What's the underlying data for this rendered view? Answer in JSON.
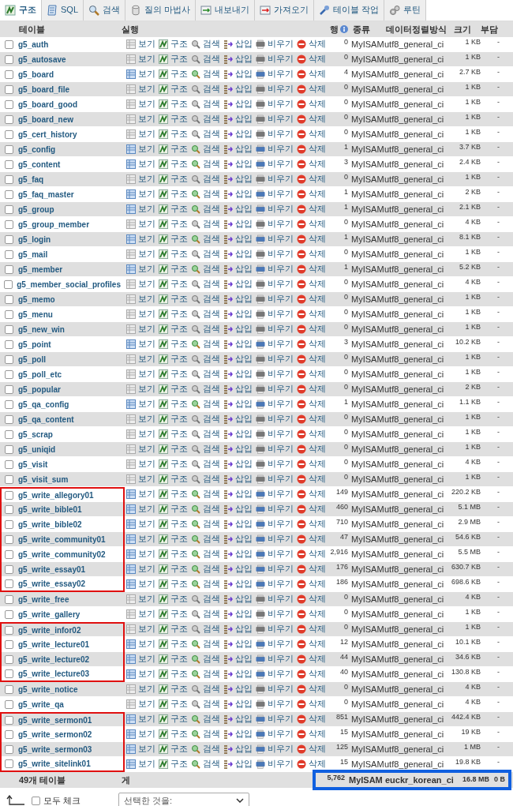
{
  "tabs": [
    {
      "label": "구조",
      "selected": true
    },
    {
      "label": "SQL",
      "selected": false
    },
    {
      "label": "검색",
      "selected": false
    },
    {
      "label": "질의 마법사",
      "selected": false
    },
    {
      "label": "내보내기",
      "selected": false
    },
    {
      "label": "가져오기",
      "selected": false
    },
    {
      "label": "테이블 작업",
      "selected": false
    },
    {
      "label": "루틴",
      "selected": false
    }
  ],
  "columns": [
    "테이블",
    "실행",
    "행",
    "종류",
    "데이터정렬방식",
    "크기",
    "부담"
  ],
  "rows": [
    {
      "name": "g5_auth",
      "actions": [
        "보기",
        "구조",
        "검색",
        "삽입",
        "비우기",
        "삭제"
      ],
      "rows": "0",
      "type": "MyISAM",
      "collation": "utf8_general_ci",
      "size": "1 KB",
      "overhead": "-",
      "has_data": false,
      "highlighted": false
    },
    {
      "name": "g5_autosave",
      "actions": [
        "보기",
        "구조",
        "검색",
        "삽입",
        "비우기",
        "삭제"
      ],
      "rows": "0",
      "type": "MyISAM",
      "collation": "utf8_general_ci",
      "size": "1 KB",
      "overhead": "-",
      "has_data": false,
      "highlighted": false
    },
    {
      "name": "g5_board",
      "actions": [
        "보기",
        "구조",
        "검색",
        "삽입",
        "비우기",
        "삭제"
      ],
      "rows": "4",
      "type": "MyISAM",
      "collation": "utf8_general_ci",
      "size": "2.7 KB",
      "overhead": "-",
      "has_data": true,
      "highlighted": false
    },
    {
      "name": "g5_board_file",
      "actions": [
        "보기",
        "구조",
        "검색",
        "삽입",
        "비우기",
        "삭제"
      ],
      "rows": "0",
      "type": "MyISAM",
      "collation": "utf8_general_ci",
      "size": "1 KB",
      "overhead": "-",
      "has_data": false,
      "highlighted": false
    },
    {
      "name": "g5_board_good",
      "actions": [
        "보기",
        "구조",
        "검색",
        "삽입",
        "비우기",
        "삭제"
      ],
      "rows": "0",
      "type": "MyISAM",
      "collation": "utf8_general_ci",
      "size": "1 KB",
      "overhead": "-",
      "has_data": false,
      "highlighted": false
    },
    {
      "name": "g5_board_new",
      "actions": [
        "보기",
        "구조",
        "검색",
        "삽입",
        "비우기",
        "삭제"
      ],
      "rows": "0",
      "type": "MyISAM",
      "collation": "utf8_general_ci",
      "size": "1 KB",
      "overhead": "-",
      "has_data": false,
      "highlighted": false
    },
    {
      "name": "g5_cert_history",
      "actions": [
        "보기",
        "구조",
        "검색",
        "삽입",
        "비우기",
        "삭제"
      ],
      "rows": "0",
      "type": "MyISAM",
      "collation": "utf8_general_ci",
      "size": "1 KB",
      "overhead": "-",
      "has_data": false,
      "highlighted": false
    },
    {
      "name": "g5_config",
      "actions": [
        "보기",
        "구조",
        "검색",
        "삽입",
        "비우기",
        "삭제"
      ],
      "rows": "1",
      "type": "MyISAM",
      "collation": "utf8_general_ci",
      "size": "3.7 KB",
      "overhead": "-",
      "has_data": true,
      "highlighted": false
    },
    {
      "name": "g5_content",
      "actions": [
        "보기",
        "구조",
        "검색",
        "삽입",
        "비우기",
        "삭제"
      ],
      "rows": "3",
      "type": "MyISAM",
      "collation": "utf8_general_ci",
      "size": "2.4 KB",
      "overhead": "-",
      "has_data": true,
      "highlighted": false
    },
    {
      "name": "g5_faq",
      "actions": [
        "보기",
        "구조",
        "검색",
        "삽입",
        "비우기",
        "삭제"
      ],
      "rows": "0",
      "type": "MyISAM",
      "collation": "utf8_general_ci",
      "size": "1 KB",
      "overhead": "-",
      "has_data": false,
      "highlighted": false
    },
    {
      "name": "g5_faq_master",
      "actions": [
        "보기",
        "구조",
        "검색",
        "삽입",
        "비우기",
        "삭제"
      ],
      "rows": "1",
      "type": "MyISAM",
      "collation": "utf8_general_ci",
      "size": "2 KB",
      "overhead": "-",
      "has_data": true,
      "highlighted": false
    },
    {
      "name": "g5_group",
      "actions": [
        "보기",
        "구조",
        "검색",
        "삽입",
        "비우기",
        "삭제"
      ],
      "rows": "1",
      "type": "MyISAM",
      "collation": "utf8_general_ci",
      "size": "2.1 KB",
      "overhead": "-",
      "has_data": true,
      "highlighted": false
    },
    {
      "name": "g5_group_member",
      "actions": [
        "보기",
        "구조",
        "검색",
        "삽입",
        "비우기",
        "삭제"
      ],
      "rows": "0",
      "type": "MyISAM",
      "collation": "utf8_general_ci",
      "size": "4 KB",
      "overhead": "-",
      "has_data": false,
      "highlighted": false
    },
    {
      "name": "g5_login",
      "actions": [
        "보기",
        "구조",
        "검색",
        "삽입",
        "비우기",
        "삭제"
      ],
      "rows": "1",
      "type": "MyISAM",
      "collation": "utf8_general_ci",
      "size": "8.1 KB",
      "overhead": "-",
      "has_data": true,
      "highlighted": false
    },
    {
      "name": "g5_mail",
      "actions": [
        "보기",
        "구조",
        "검색",
        "삽입",
        "비우기",
        "삭제"
      ],
      "rows": "0",
      "type": "MyISAM",
      "collation": "utf8_general_ci",
      "size": "1 KB",
      "overhead": "-",
      "has_data": false,
      "highlighted": false
    },
    {
      "name": "g5_member",
      "actions": [
        "보기",
        "구조",
        "검색",
        "삽입",
        "비우기",
        "삭제"
      ],
      "rows": "1",
      "type": "MyISAM",
      "collation": "utf8_general_ci",
      "size": "5.2 KB",
      "overhead": "-",
      "has_data": true,
      "highlighted": false
    },
    {
      "name": "g5_member_social_profiles",
      "actions": [
        "보기",
        "구조",
        "검색",
        "삽입",
        "비우기",
        "삭제"
      ],
      "rows": "0",
      "type": "MyISAM",
      "collation": "utf8_general_ci",
      "size": "4 KB",
      "overhead": "-",
      "has_data": false,
      "highlighted": false
    },
    {
      "name": "g5_memo",
      "actions": [
        "보기",
        "구조",
        "검색",
        "삽입",
        "비우기",
        "삭제"
      ],
      "rows": "0",
      "type": "MyISAM",
      "collation": "utf8_general_ci",
      "size": "1 KB",
      "overhead": "-",
      "has_data": false,
      "highlighted": false
    },
    {
      "name": "g5_menu",
      "actions": [
        "보기",
        "구조",
        "검색",
        "삽입",
        "비우기",
        "삭제"
      ],
      "rows": "0",
      "type": "MyISAM",
      "collation": "utf8_general_ci",
      "size": "1 KB",
      "overhead": "-",
      "has_data": false,
      "highlighted": false
    },
    {
      "name": "g5_new_win",
      "actions": [
        "보기",
        "구조",
        "검색",
        "삽입",
        "비우기",
        "삭제"
      ],
      "rows": "0",
      "type": "MyISAM",
      "collation": "utf8_general_ci",
      "size": "1 KB",
      "overhead": "-",
      "has_data": false,
      "highlighted": false
    },
    {
      "name": "g5_point",
      "actions": [
        "보기",
        "구조",
        "검색",
        "삽입",
        "비우기",
        "삭제"
      ],
      "rows": "3",
      "type": "MyISAM",
      "collation": "utf8_general_ci",
      "size": "10.2 KB",
      "overhead": "-",
      "has_data": true,
      "highlighted": false
    },
    {
      "name": "g5_poll",
      "actions": [
        "보기",
        "구조",
        "검색",
        "삽입",
        "비우기",
        "삭제"
      ],
      "rows": "0",
      "type": "MyISAM",
      "collation": "utf8_general_ci",
      "size": "1 KB",
      "overhead": "-",
      "has_data": false,
      "highlighted": false
    },
    {
      "name": "g5_poll_etc",
      "actions": [
        "보기",
        "구조",
        "검색",
        "삽입",
        "비우기",
        "삭제"
      ],
      "rows": "0",
      "type": "MyISAM",
      "collation": "utf8_general_ci",
      "size": "1 KB",
      "overhead": "-",
      "has_data": false,
      "highlighted": false
    },
    {
      "name": "g5_popular",
      "actions": [
        "보기",
        "구조",
        "검색",
        "삽입",
        "비우기",
        "삭제"
      ],
      "rows": "0",
      "type": "MyISAM",
      "collation": "utf8_general_ci",
      "size": "2 KB",
      "overhead": "-",
      "has_data": false,
      "highlighted": false
    },
    {
      "name": "g5_qa_config",
      "actions": [
        "보기",
        "구조",
        "검색",
        "삽입",
        "비우기",
        "삭제"
      ],
      "rows": "1",
      "type": "MyISAM",
      "collation": "utf8_general_ci",
      "size": "1.1 KB",
      "overhead": "-",
      "has_data": true,
      "highlighted": false
    },
    {
      "name": "g5_qa_content",
      "actions": [
        "보기",
        "구조",
        "검색",
        "삽입",
        "비우기",
        "삭제"
      ],
      "rows": "0",
      "type": "MyISAM",
      "collation": "utf8_general_ci",
      "size": "1 KB",
      "overhead": "-",
      "has_data": false,
      "highlighted": false
    },
    {
      "name": "g5_scrap",
      "actions": [
        "보기",
        "구조",
        "검색",
        "삽입",
        "비우기",
        "삭제"
      ],
      "rows": "0",
      "type": "MyISAM",
      "collation": "utf8_general_ci",
      "size": "1 KB",
      "overhead": "-",
      "has_data": false,
      "highlighted": false
    },
    {
      "name": "g5_uniqid",
      "actions": [
        "보기",
        "구조",
        "검색",
        "삽입",
        "비우기",
        "삭제"
      ],
      "rows": "0",
      "type": "MyISAM",
      "collation": "utf8_general_ci",
      "size": "1 KB",
      "overhead": "-",
      "has_data": false,
      "highlighted": false
    },
    {
      "name": "g5_visit",
      "actions": [
        "보기",
        "구조",
        "검색",
        "삽입",
        "비우기",
        "삭제"
      ],
      "rows": "0",
      "type": "MyISAM",
      "collation": "utf8_general_ci",
      "size": "4 KB",
      "overhead": "-",
      "has_data": false,
      "highlighted": false
    },
    {
      "name": "g5_visit_sum",
      "actions": [
        "보기",
        "구조",
        "검색",
        "삽입",
        "비우기",
        "삭제"
      ],
      "rows": "0",
      "type": "MyISAM",
      "collation": "utf8_general_ci",
      "size": "1 KB",
      "overhead": "-",
      "has_data": false,
      "highlighted": false
    },
    {
      "name": "g5_write_allegory01",
      "actions": [
        "보기",
        "구조",
        "검색",
        "삽입",
        "비우기",
        "삭제"
      ],
      "rows": "149",
      "type": "MyISAM",
      "collation": "utf8_general_ci",
      "size": "220.2 KB",
      "overhead": "-",
      "has_data": true,
      "highlighted": true
    },
    {
      "name": "g5_write_bible01",
      "actions": [
        "보기",
        "구조",
        "검색",
        "삽입",
        "비우기",
        "삭제"
      ],
      "rows": "460",
      "type": "MyISAM",
      "collation": "utf8_general_ci",
      "size": "5.1 MB",
      "overhead": "-",
      "has_data": true,
      "highlighted": true
    },
    {
      "name": "g5_write_bible02",
      "actions": [
        "보기",
        "구조",
        "검색",
        "삽입",
        "비우기",
        "삭제"
      ],
      "rows": "710",
      "type": "MyISAM",
      "collation": "utf8_general_ci",
      "size": "2.9 MB",
      "overhead": "-",
      "has_data": true,
      "highlighted": true
    },
    {
      "name": "g5_write_community01",
      "actions": [
        "보기",
        "구조",
        "검색",
        "삽입",
        "비우기",
        "삭제"
      ],
      "rows": "47",
      "type": "MyISAM",
      "collation": "utf8_general_ci",
      "size": "54.6 KB",
      "overhead": "-",
      "has_data": true,
      "highlighted": true
    },
    {
      "name": "g5_write_community02",
      "actions": [
        "보기",
        "구조",
        "검색",
        "삽입",
        "비우기",
        "삭제"
      ],
      "rows": "2,916",
      "type": "MyISAM",
      "collation": "utf8_general_ci",
      "size": "5.5 MB",
      "overhead": "-",
      "has_data": true,
      "highlighted": true
    },
    {
      "name": "g5_write_essay01",
      "actions": [
        "보기",
        "구조",
        "검색",
        "삽입",
        "비우기",
        "삭제"
      ],
      "rows": "176",
      "type": "MyISAM",
      "collation": "utf8_general_ci",
      "size": "630.7 KB",
      "overhead": "-",
      "has_data": true,
      "highlighted": true
    },
    {
      "name": "g5_write_essay02",
      "actions": [
        "보기",
        "구조",
        "검색",
        "삽입",
        "비우기",
        "삭제"
      ],
      "rows": "186",
      "type": "MyISAM",
      "collation": "utf8_general_ci",
      "size": "698.6 KB",
      "overhead": "-",
      "has_data": true,
      "highlighted": true
    },
    {
      "name": "g5_write_free",
      "actions": [
        "보기",
        "구조",
        "검색",
        "삽입",
        "비우기",
        "삭제"
      ],
      "rows": "0",
      "type": "MyISAM",
      "collation": "utf8_general_ci",
      "size": "4 KB",
      "overhead": "-",
      "has_data": false,
      "highlighted": false
    },
    {
      "name": "g5_write_gallery",
      "actions": [
        "보기",
        "구조",
        "검색",
        "삽입",
        "비우기",
        "삭제"
      ],
      "rows": "0",
      "type": "MyISAM",
      "collation": "utf8_general_ci",
      "size": "1 KB",
      "overhead": "-",
      "has_data": false,
      "highlighted": false
    },
    {
      "name": "g5_write_infor02",
      "actions": [
        "보기",
        "구조",
        "검색",
        "삽입",
        "비우기",
        "삭제"
      ],
      "rows": "0",
      "type": "MyISAM",
      "collation": "utf8_general_ci",
      "size": "1 KB",
      "overhead": "-",
      "has_data": false,
      "highlighted": true
    },
    {
      "name": "g5_write_lecture01",
      "actions": [
        "보기",
        "구조",
        "검색",
        "삽입",
        "비우기",
        "삭제"
      ],
      "rows": "12",
      "type": "MyISAM",
      "collation": "utf8_general_ci",
      "size": "10.1 KB",
      "overhead": "-",
      "has_data": true,
      "highlighted": true
    },
    {
      "name": "g5_write_lecture02",
      "actions": [
        "보기",
        "구조",
        "검색",
        "삽입",
        "비우기",
        "삭제"
      ],
      "rows": "44",
      "type": "MyISAM",
      "collation": "utf8_general_ci",
      "size": "34.6 KB",
      "overhead": "-",
      "has_data": true,
      "highlighted": true
    },
    {
      "name": "g5_write_lecture03",
      "actions": [
        "보기",
        "구조",
        "검색",
        "삽입",
        "비우기",
        "삭제"
      ],
      "rows": "40",
      "type": "MyISAM",
      "collation": "utf8_general_ci",
      "size": "130.8 KB",
      "overhead": "-",
      "has_data": true,
      "highlighted": true
    },
    {
      "name": "g5_write_notice",
      "actions": [
        "보기",
        "구조",
        "검색",
        "삽입",
        "비우기",
        "삭제"
      ],
      "rows": "0",
      "type": "MyISAM",
      "collation": "utf8_general_ci",
      "size": "4 KB",
      "overhead": "-",
      "has_data": false,
      "highlighted": false
    },
    {
      "name": "g5_write_qa",
      "actions": [
        "보기",
        "구조",
        "검색",
        "삽입",
        "비우기",
        "삭제"
      ],
      "rows": "0",
      "type": "MyISAM",
      "collation": "utf8_general_ci",
      "size": "4 KB",
      "overhead": "-",
      "has_data": false,
      "highlighted": false
    },
    {
      "name": "g5_write_sermon01",
      "actions": [
        "보기",
        "구조",
        "검색",
        "삽입",
        "비우기",
        "삭제"
      ],
      "rows": "851",
      "type": "MyISAM",
      "collation": "utf8_general_ci",
      "size": "442.4 KB",
      "overhead": "-",
      "has_data": true,
      "highlighted": true
    },
    {
      "name": "g5_write_sermon02",
      "actions": [
        "보기",
        "구조",
        "검색",
        "삽입",
        "비우기",
        "삭제"
      ],
      "rows": "15",
      "type": "MyISAM",
      "collation": "utf8_general_ci",
      "size": "19 KB",
      "overhead": "-",
      "has_data": true,
      "highlighted": true
    },
    {
      "name": "g5_write_sermon03",
      "actions": [
        "보기",
        "구조",
        "검색",
        "삽입",
        "비우기",
        "삭제"
      ],
      "rows": "125",
      "type": "MyISAM",
      "collation": "utf8_general_ci",
      "size": "1 MB",
      "overhead": "-",
      "has_data": true,
      "highlighted": true
    },
    {
      "name": "g5_write_sitelink01",
      "actions": [
        "보기",
        "구조",
        "검색",
        "삽입",
        "비우기",
        "삭제"
      ],
      "rows": "15",
      "type": "MyISAM",
      "collation": "utf8_general_ci",
      "size": "19.8 KB",
      "overhead": "-",
      "has_data": true,
      "highlighted": true
    }
  ],
  "footer": {
    "count": "49개 테이블",
    "label": "게",
    "rows": "5,762",
    "type": "MyISAM",
    "collation": "euckr_korean_ci",
    "size": "16.8 MB",
    "overhead": "0 B",
    "highlighted": true
  },
  "bottom": {
    "check_all": {
      "label": "모두 체크",
      "checked": false
    },
    "select": {
      "value": "선택한 것을:"
    }
  }
}
